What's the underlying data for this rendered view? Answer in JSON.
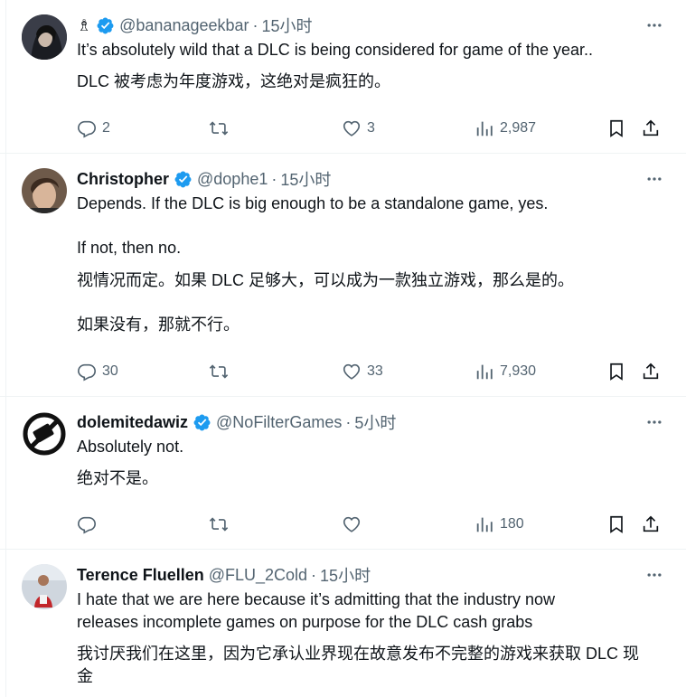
{
  "tweets": [
    {
      "name": "♗",
      "handle": "@bananageekbar",
      "time": "15小时",
      "text": "It’s absolutely wild that a DLC is being considered for game of the year..",
      "translation": "DLC 被考虑为年度游戏，这绝对是疯狂的。",
      "replies": "2",
      "retweets": "",
      "likes": "3",
      "views": "2,987"
    },
    {
      "name": "Christopher",
      "handle": "@dophe1",
      "time": "15小时",
      "text_line1": "Depends. If the DLC is big enough to be a standalone game, yes.",
      "text_line2": "If not, then no.",
      "translation_line1": "视情况而定。如果 DLC 足够大，可以成为一款独立游戏，那么是的。",
      "translation_line2": "如果没有，那就不行。",
      "replies": "30",
      "retweets": "",
      "likes": "33",
      "views": "7,930"
    },
    {
      "name": "dolemitedawiz",
      "handle": "@NoFilterGames",
      "time": "5小时",
      "text": "Absolutely not.",
      "translation": "绝对不是。",
      "replies": "",
      "retweets": "",
      "likes": "",
      "views": "180"
    },
    {
      "name": "Terence Fluellen",
      "handle": "@FLU_2Cold",
      "time": "15小时",
      "text_line1": "I hate that we are here because it’s admitting that the industry now",
      "text_line2": "releases incomplete games on purpose for the DLC cash grabs",
      "translation_line1": "我讨厌我们在这里，因为它承认业界现在故意发布不完整的游戏来获取 DLC 现",
      "translation_line2": "金"
    }
  ],
  "colors": {
    "verified": "#1d9bf0",
    "secondary_text": "#536471",
    "divider": "#eff3f4"
  },
  "icons": [
    "verified-icon",
    "more-icon",
    "reply-icon",
    "retweet-icon",
    "like-icon",
    "views-icon",
    "bookmark-icon",
    "share-icon"
  ]
}
